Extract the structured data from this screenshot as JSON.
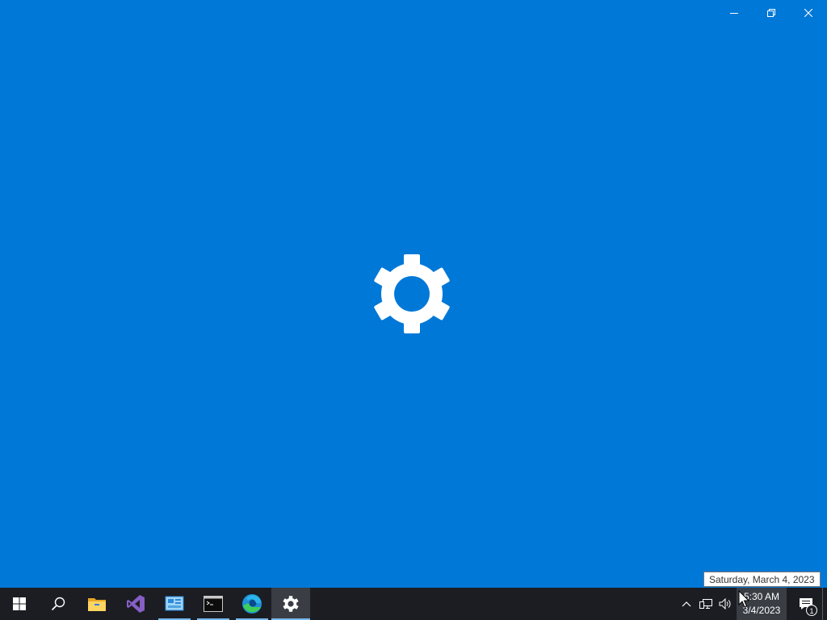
{
  "window": {
    "controls": {
      "minimize_icon": "minimize-icon",
      "restore_icon": "restore-icon",
      "close_icon": "close-icon"
    }
  },
  "splash": {
    "icon": "gear-icon",
    "color": "#ffffff",
    "background": "#0078d7"
  },
  "tooltip": {
    "text": "Saturday, March 4, 2023"
  },
  "taskbar": {
    "background": "#1b1d22",
    "pinned": [
      {
        "name": "start",
        "icon": "windows-logo-icon"
      },
      {
        "name": "search",
        "icon": "search-icon"
      },
      {
        "name": "file-explorer",
        "icon": "folder-icon"
      },
      {
        "name": "visual-studio",
        "icon": "visual-studio-icon"
      },
      {
        "name": "control-panel",
        "icon": "control-panel-icon"
      },
      {
        "name": "command-prompt",
        "icon": "terminal-icon"
      },
      {
        "name": "edge",
        "icon": "edge-icon"
      },
      {
        "name": "settings",
        "icon": "gear-icon",
        "active": true
      }
    ],
    "tray": {
      "icons": [
        "chevron-up-icon",
        "network-icon",
        "volume-icon"
      ],
      "clock": {
        "time": "5:30 AM",
        "date": "3/4/2023"
      },
      "notifications": {
        "icon": "notification-icon",
        "count": "1"
      }
    }
  }
}
